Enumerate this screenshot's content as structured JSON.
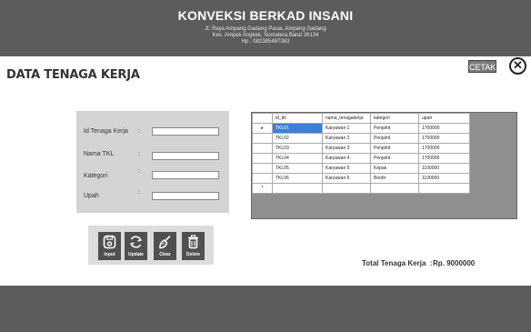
{
  "header": {
    "app_title": "KONVEKSI BERKAD INSANI",
    "address_line1": "Jl. Raya Ampang Gadang Pasia, Ampang Gadang",
    "address_line2": "Kec. Ampek Angkek, Sumatera Barat 26134",
    "address_line3": "Hp : 082385487383"
  },
  "page": {
    "title": "DATA TENAGA KERJA",
    "cetak_label": "CETAK",
    "close_glyph": "✕"
  },
  "form": {
    "fields": [
      {
        "label": "Id Tenaga Kerja",
        "colon": ":",
        "value": ""
      },
      {
        "label": "Nama TKL",
        "colon": ":",
        "value": ""
      },
      {
        "label": "Kategori",
        "colon": ":",
        "value": ""
      },
      {
        "label": "Upah",
        "colon": ":",
        "value": ""
      }
    ]
  },
  "buttons": {
    "input": "Input",
    "update": "Update",
    "clear": "Clear",
    "delete": "Delete"
  },
  "grid": {
    "columns": [
      "id_tkl",
      "nama_tenagakerja",
      "kategori",
      "upah"
    ],
    "current_row_marker": "▸",
    "new_row_marker": "*",
    "rows": [
      [
        "TKL01",
        "Karyawan 1",
        "Penjahit",
        "1700000"
      ],
      [
        "TKL02",
        "Karyawan 2",
        "Penjahit",
        "1700000"
      ],
      [
        "TKL03",
        "Karyawan 3",
        "Penjahit",
        "1700000"
      ],
      [
        "TKL04",
        "Karyawan 4",
        "Penjahit",
        "1700000"
      ],
      [
        "TKL05",
        "Karyawan 5",
        "Kepak",
        "1100000"
      ],
      [
        "TKL06",
        "Karyawan 6",
        "Bordir",
        "1100000"
      ]
    ]
  },
  "summary": {
    "label": "Total Tenaga Kerja",
    "separator": ":",
    "value": "Rp. 9000000"
  },
  "colors": {
    "header_bg": "#5c5c5c",
    "selection": "#3b80dd",
    "button_bg": "#505050"
  }
}
